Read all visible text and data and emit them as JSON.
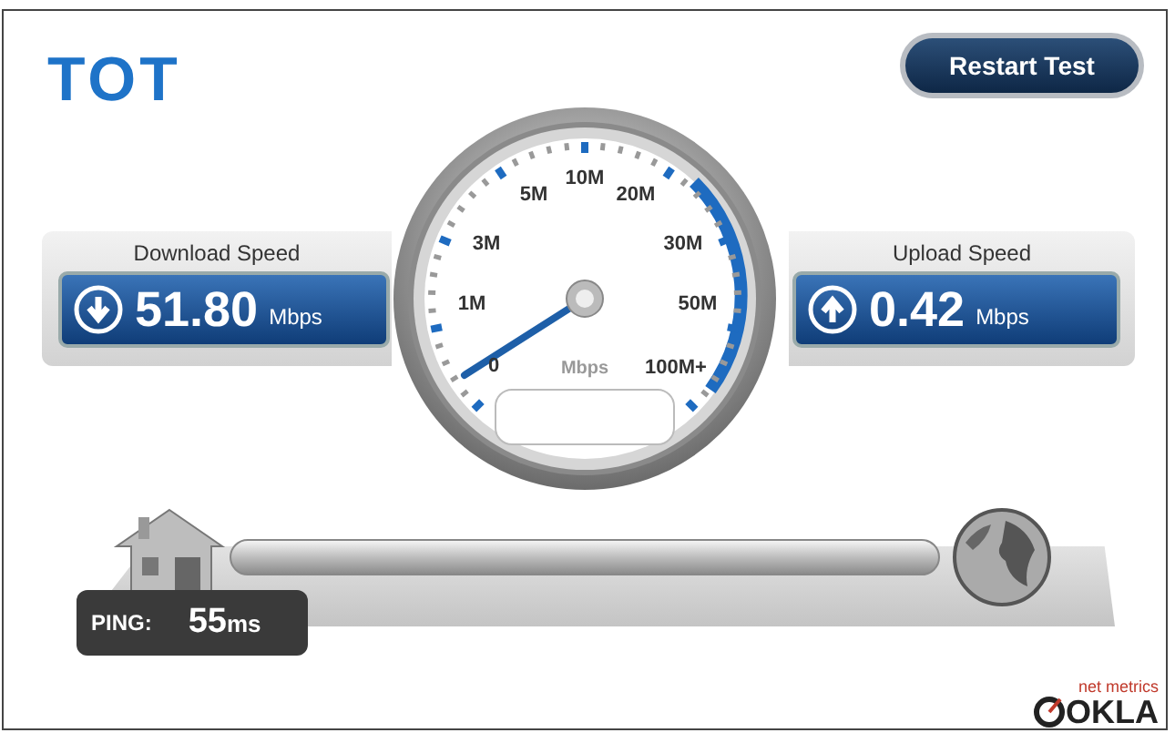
{
  "logo": "TOT",
  "restart_button": "Restart Test",
  "download": {
    "label": "Download Speed",
    "value": "51.80",
    "unit": "Mbps"
  },
  "gauge": {
    "scale_labels": [
      "10M",
      "5M",
      "20M",
      "3M",
      "30M",
      "1M",
      "50M",
      "0",
      "100M+"
    ],
    "unit": "Mbps"
  },
  "upload": {
    "label": "Upload Speed",
    "value": "0.42",
    "unit": "Mbps"
  },
  "ping": {
    "label": "PING:",
    "value": "55",
    "unit": "ms"
  },
  "footer": {
    "tagline": "net metrics",
    "brand": "OKLA"
  }
}
